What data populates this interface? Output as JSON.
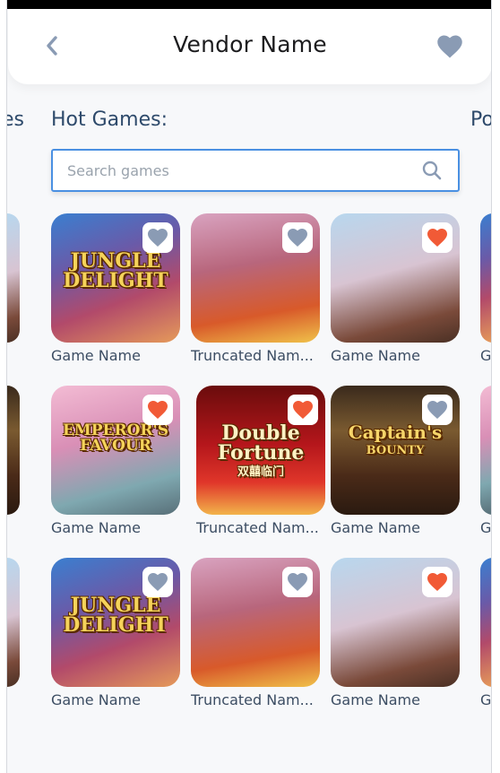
{
  "header": {
    "title": "Vendor Name",
    "back_icon": "chevron-left-icon",
    "favorite_icon": "heart-icon",
    "favorite_color": "#8a9bb4"
  },
  "tabs": {
    "prev": "es",
    "current": "Hot Games:",
    "next": "Po"
  },
  "search": {
    "placeholder": "Search games",
    "icon": "search-icon",
    "border_color": "#4a90e2"
  },
  "colors": {
    "favorite_active": "#f15a36",
    "favorite_inactive": "#8a9bb4"
  },
  "rows": [
    {
      "edge_name_right": "G",
      "cards": [
        {
          "name": "Game Name",
          "art": "jungle",
          "art_text": "JUNGLE DELIGHT",
          "favorite": false
        },
        {
          "name": "Truncated Nam...",
          "art": "monkey",
          "art_text": "",
          "favorite": false
        },
        {
          "name": "Game Name",
          "art": "girl",
          "art_text": "",
          "favorite": true
        }
      ]
    },
    {
      "edge_name_right": "G",
      "cards": [
        {
          "name": "Game Name",
          "art": "emperor",
          "art_text": "EMPEROR'S FAVOUR",
          "favorite": true
        },
        {
          "name": "Truncated Nam...",
          "art": "double",
          "art_text": "Double Fortune",
          "art_subtext": "双囍临门",
          "favorite": true
        },
        {
          "name": "Game Name",
          "art": "captain",
          "art_text": "Captain's",
          "art_subtext": "BOUNTY",
          "favorite": false
        }
      ]
    },
    {
      "edge_name_right": "G",
      "cards": [
        {
          "name": "Game Name",
          "art": "jungle",
          "art_text": "JUNGLE DELIGHT",
          "favorite": false
        },
        {
          "name": "Truncated Nam...",
          "art": "monkey",
          "art_text": "",
          "favorite": false
        },
        {
          "name": "Game Name",
          "art": "girl",
          "art_text": "",
          "favorite": true
        }
      ]
    }
  ]
}
